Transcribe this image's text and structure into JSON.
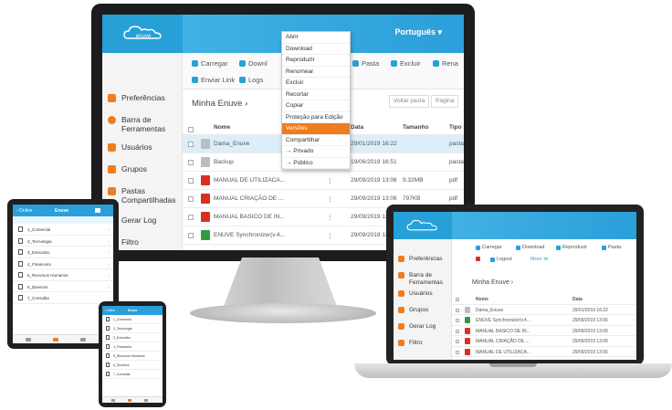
{
  "brand": {
    "logo_text": "enuve"
  },
  "desktop": {
    "language": "Português ▾",
    "sidebar": [
      {
        "label": "Preferências",
        "color": "#f07c1e"
      },
      {
        "label": "Barra de Ferramentas",
        "color": "#f07c1e"
      },
      {
        "label": "Usuários",
        "color": "#f07c1e"
      },
      {
        "label": "Grupos",
        "color": "#f07c1e"
      },
      {
        "label": "Pastas Compartilhadas",
        "color": "#f07c1e"
      },
      {
        "label": "Gerar Log",
        "color": "#f07c1e"
      },
      {
        "label": "Filtro",
        "color": "#f07c1e"
      }
    ],
    "toolbar": {
      "carregar": "Carregar",
      "download": "Downl",
      "pasta": "Pasta",
      "excluir": "Excluir",
      "renomear": "Rena",
      "enviar_link": "Enviar Link",
      "logs": "Logs"
    },
    "breadcrumb": "Minha Enuve  ›",
    "voltar_pasta": "Voltar pasta",
    "pagina": "Página",
    "columns": {
      "nome": "Nome",
      "data": "Data",
      "tamanho": "Tamanho",
      "tipo": "Tipo"
    },
    "rows": [
      {
        "name": "Dama_Enuve",
        "date": "29/01/2019 16:22",
        "size": "",
        "type": "pasta",
        "icon": "folder",
        "selected": true
      },
      {
        "name": "Backup",
        "date": "19/06/2019 16:51",
        "size": "",
        "type": "pasta",
        "icon": "folder",
        "selected": false
      },
      {
        "name": "MANUAL DE UTILIZACA...",
        "date": "29/09/2019 13:06",
        "size": "9.32MB",
        "type": "pdf",
        "icon": "pdf",
        "selected": false
      },
      {
        "name": "MANUAL CRIAÇÃO DE ...",
        "date": "29/09/2019 13:06",
        "size": "797KB",
        "type": "pdf",
        "icon": "pdf",
        "selected": false
      },
      {
        "name": "MANUAL BASICO DE IN...",
        "date": "29/09/2019 13:06",
        "size": "",
        "type": "pdf",
        "icon": "pdf",
        "selected": false
      },
      {
        "name": "ENUVE Synchronizer(v.4...",
        "date": "29/09/2019 13:06",
        "size": "",
        "type": "pdf",
        "icon": "xls",
        "selected": false
      }
    ],
    "context_menu": [
      {
        "label": "Abrir",
        "active": false
      },
      {
        "label": "Download",
        "active": false
      },
      {
        "label": "Reproduzir",
        "active": false
      },
      {
        "label": "Renomear",
        "active": false
      },
      {
        "label": "Excluir",
        "active": false
      },
      {
        "label": "Recortar",
        "active": false
      },
      {
        "label": "Copiar",
        "active": false
      },
      {
        "label": "Proteção para Edição",
        "active": false
      },
      {
        "label": "Versões",
        "active": true
      },
      {
        "label": "Compartilhar",
        "active": false
      },
      {
        "label": "→ Privado",
        "active": false
      },
      {
        "label": "→ Público",
        "active": false
      }
    ]
  },
  "laptop": {
    "sidebar": [
      "Preferências",
      "Barra de Ferramentas",
      "Usuários",
      "Grupos",
      "Gerar Log",
      "Filtro"
    ],
    "toolbar": {
      "carregar": "Carregar",
      "download": "Download",
      "reproduzir": "Reproduzir",
      "pasta": "Pasta",
      "logout": "Logout",
      "more": "More ≫"
    },
    "breadcrumb": "Minha Enuve  ›",
    "columns": {
      "nome": "Nome",
      "data": "Data"
    },
    "rows": [
      {
        "name": "Dama_Enuve",
        "date": "29/01/2019 16:22",
        "icon": "folder"
      },
      {
        "name": "ENUVE Synchronizer(v.4...",
        "date": "29/09/2019 13:06",
        "icon": "xls"
      },
      {
        "name": "MANUAL BASICO DE IN...",
        "date": "29/09/2019 13:06",
        "icon": "pdf"
      },
      {
        "name": "MANUAL CRIAÇÃO DE ...",
        "date": "29/09/2019 13:06",
        "icon": "pdf"
      },
      {
        "name": "MANUAL DE UTILIZACA...",
        "date": "29/09/2019 13:06",
        "icon": "pdf"
      }
    ]
  },
  "tablet": {
    "back": "‹ Online",
    "title": "Enuve",
    "items": [
      "1_Comercial",
      "2_Tecnologia",
      "3_Executivo",
      "4_Financeiro",
      "5_Recursos Humanos",
      "6_Diversos",
      "7_Consultia"
    ]
  },
  "phone": {
    "back": "‹ Online",
    "title": "Enuve",
    "items": [
      "1_Comercial",
      "2_Tecnologia",
      "3_Executivo",
      "4_Financeiro",
      "5_Recursos Humanos",
      "6_Diversos",
      "7_Consultia"
    ]
  },
  "colors": {
    "brand_blue": "#2a9fd9",
    "accent_orange": "#f07c1e",
    "pdf_red": "#d93025",
    "excel_green": "#2e9b46"
  }
}
